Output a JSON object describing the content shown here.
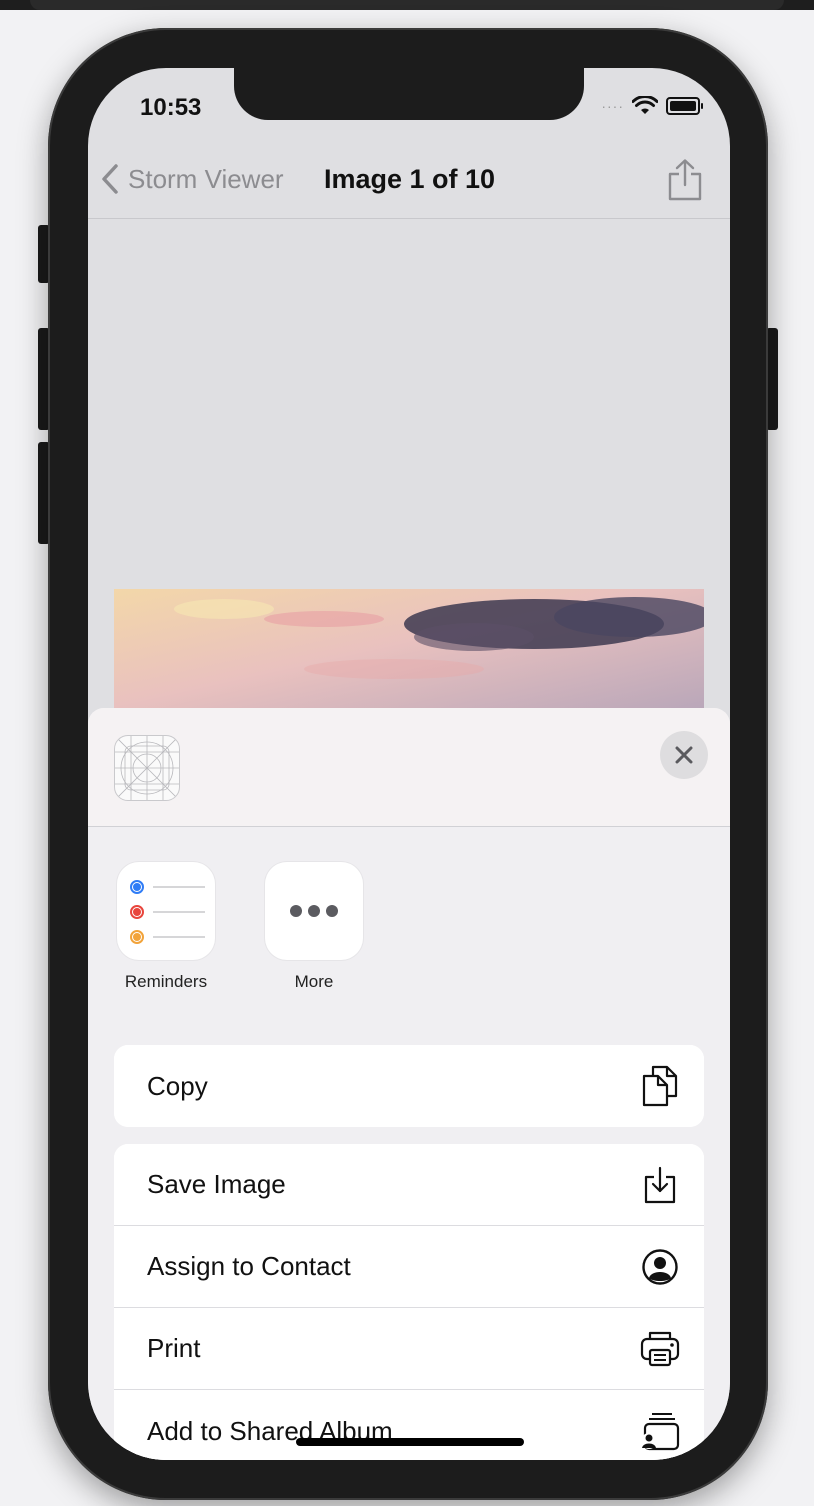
{
  "status_bar": {
    "time": "10:53"
  },
  "nav": {
    "back_label": "Storm Viewer",
    "title": "Image 1 of 10"
  },
  "apps": [
    {
      "label": "Reminders"
    },
    {
      "label": "More"
    }
  ],
  "actions_primary": [
    {
      "label": "Copy",
      "icon": "copy-icon"
    }
  ],
  "actions_secondary": [
    {
      "label": "Save Image",
      "icon": "save-image-icon"
    },
    {
      "label": "Assign to Contact",
      "icon": "contact-icon"
    },
    {
      "label": "Print",
      "icon": "printer-icon"
    },
    {
      "label": "Add to Shared Album",
      "icon": "shared-album-icon"
    }
  ],
  "colors": {
    "reminder_blue": "#2f7cf6",
    "reminder_red": "#e8453c",
    "reminder_orange": "#f2a33a"
  }
}
